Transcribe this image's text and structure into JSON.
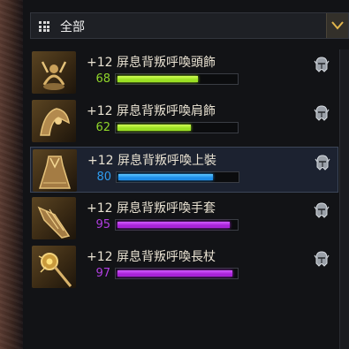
{
  "filter": {
    "label": "全部"
  },
  "items": [
    {
      "name": "+12  屏息背叛呼喚頭飾",
      "level": "68",
      "fill": 0.68,
      "color": "#9be023",
      "glow": "#d2ff55",
      "level_color": "#8fd42a",
      "icon": "headpiece-icon"
    },
    {
      "name": "+12  屏息背叛呼喚肩飾",
      "level": "62",
      "fill": 0.62,
      "color": "#9be023",
      "glow": "#d2ff55",
      "level_color": "#8fd42a",
      "icon": "shoulder-icon"
    },
    {
      "name": "+12  屏息背叛呼喚上裝",
      "level": "80",
      "fill": 0.8,
      "color": "#1f8ee8",
      "glow": "#5cc6ff",
      "level_color": "#2f9cef",
      "icon": "chest-icon"
    },
    {
      "name": "+12  屏息背叛呼喚手套",
      "level": "95",
      "fill": 0.95,
      "color": "#a923d8",
      "glow": "#d25cff",
      "level_color": "#b03ee0",
      "icon": "gloves-icon"
    },
    {
      "name": "+12  屏息背叛呼喚長杖",
      "level": "97",
      "fill": 0.97,
      "color": "#a923d8",
      "glow": "#d25cff",
      "level_color": "#b03ee0",
      "icon": "staff-icon"
    }
  ]
}
